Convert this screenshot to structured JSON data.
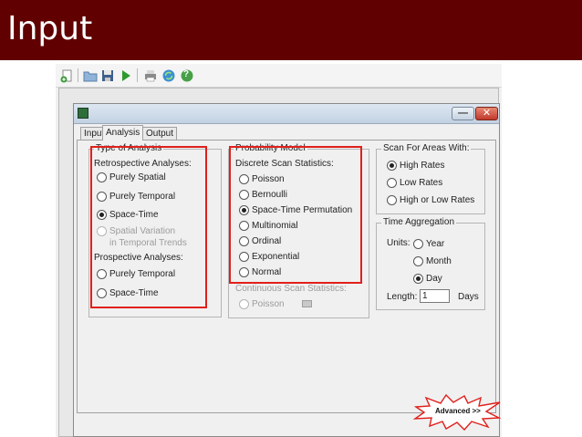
{
  "slide": {
    "title": "Input"
  },
  "toolbar": {
    "icons": [
      "new-session-icon",
      "open-session-icon",
      "save-session-icon",
      "execute-icon",
      "print-icon",
      "update-icon",
      "help-icon"
    ],
    "help_glyph": "?"
  },
  "dialog": {
    "min_glyph": "—",
    "close_glyph": "✕",
    "tabs": [
      "Input",
      "Analysis",
      "Output"
    ],
    "active_tab": "Analysis"
  },
  "type_of_analysis": {
    "title": "Type of Analysis",
    "retro_label": "Retrospective Analyses:",
    "retro_options": [
      "Purely Spatial",
      "Purely Temporal",
      "Space-Time",
      "Spatial Variation"
    ],
    "retro_option_extra": "in Temporal Trends",
    "retro_selected": "Space-Time",
    "prosp_label": "Prospective Analyses:",
    "prosp_options": [
      "Purely Temporal",
      "Space-Time"
    ]
  },
  "probability_model": {
    "title": "Probability Model",
    "discrete_label": "Discrete Scan Statistics:",
    "discrete_options": [
      "Poisson",
      "Bernoulli",
      "Space-Time Permutation",
      "Multinomial",
      "Ordinal",
      "Exponential",
      "Normal"
    ],
    "selected": "Space-Time Permutation",
    "continuous_label": "Continuous Scan Statistics:",
    "continuous_options": [
      "Poisson"
    ]
  },
  "scan_for_areas": {
    "title": "Scan For Areas With:",
    "options": [
      "High Rates",
      "Low Rates",
      "High or Low Rates"
    ],
    "selected": "High Rates"
  },
  "time_aggregation": {
    "title": "Time Aggregation",
    "units_label": "Units:",
    "options": [
      "Year",
      "Month",
      "Day"
    ],
    "selected": "Day",
    "length_label": "Length:",
    "length_value": "1",
    "days_label": "Days"
  },
  "advanced": {
    "label": "Advanced >>"
  },
  "colors": {
    "header": "#600000",
    "highlight": "#e0201c"
  }
}
